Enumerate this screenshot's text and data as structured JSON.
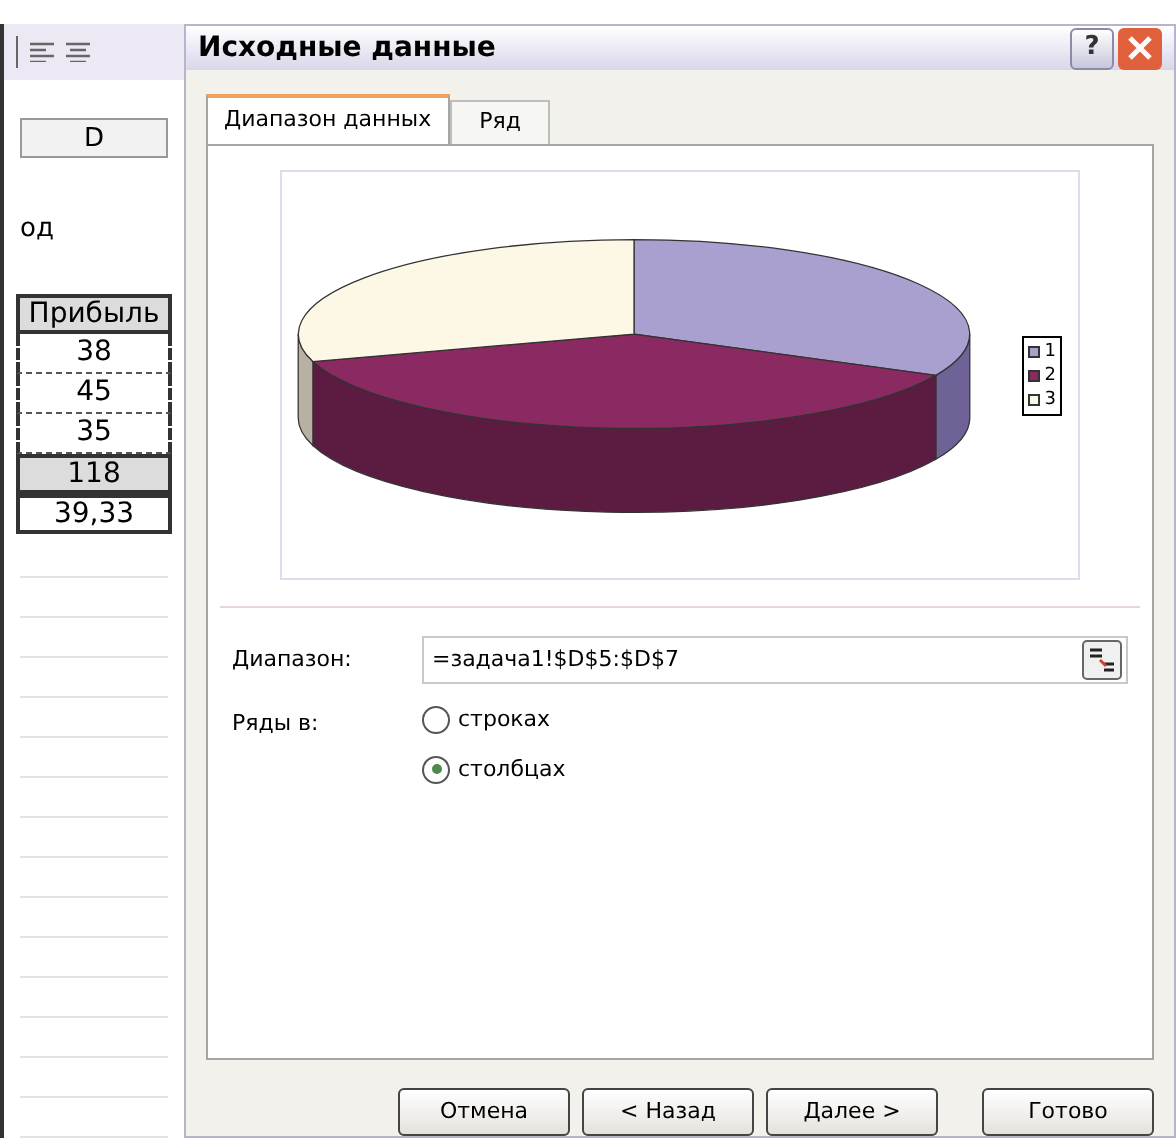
{
  "sheet": {
    "column_header": "D",
    "cells": [
      {
        "text": "од",
        "kind": "plain"
      },
      {
        "text": "Прибыль",
        "kind": "header"
      },
      {
        "text": "38",
        "kind": "marked"
      },
      {
        "text": "45",
        "kind": "marked"
      },
      {
        "text": "35",
        "kind": "marked"
      },
      {
        "text": "118",
        "kind": "total"
      },
      {
        "text": "39,33",
        "kind": "result"
      }
    ]
  },
  "dialog": {
    "title": "Исходные данные",
    "help_button": "?",
    "tabs": [
      {
        "label": "Диапазон данных",
        "selected": true
      },
      {
        "label": "Ряд",
        "selected": false
      }
    ],
    "legend": [
      {
        "label": "1",
        "color": "#a9a0d0"
      },
      {
        "label": "2",
        "color": "#8b2a62"
      },
      {
        "label": "3",
        "color": "#fdf8e6"
      }
    ],
    "range_label": "Диапазон:",
    "range_value": "=задача1!$D$5:$D$7",
    "series_label": "Ряды в:",
    "series_options": [
      {
        "label": "строках",
        "selected": false
      },
      {
        "label": "столбцах",
        "selected": true
      }
    ],
    "buttons": [
      "Отмена",
      "< Назад",
      "Далее >",
      "Готово"
    ]
  }
}
